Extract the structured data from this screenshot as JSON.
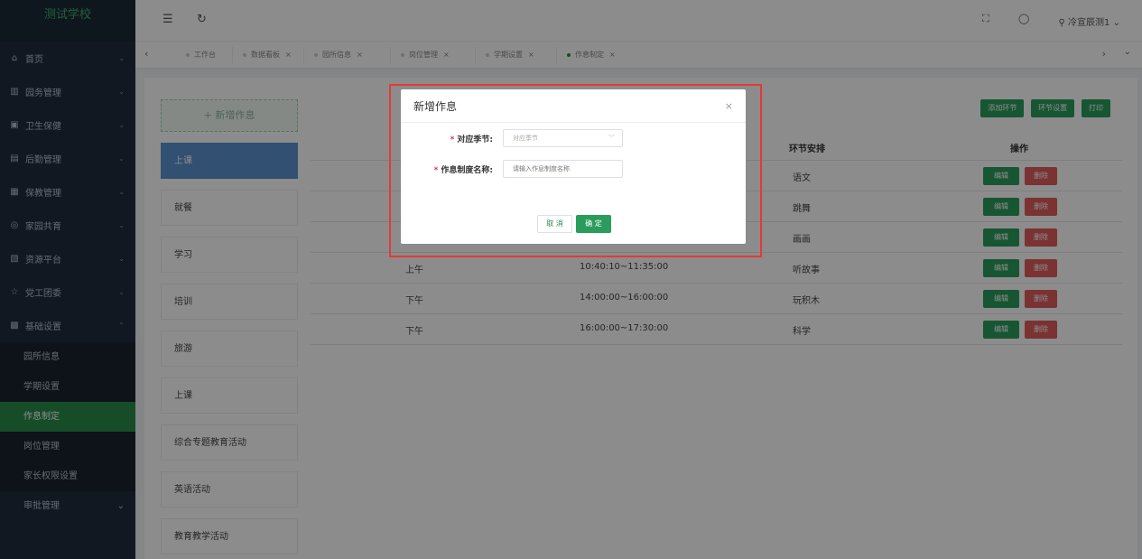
{
  "app": {
    "logo": "测试学校"
  },
  "sidebar": {
    "items": [
      {
        "icon": "home-icon",
        "glyph": "⌂",
        "label": "首页"
      },
      {
        "icon": "bank-icon",
        "glyph": "▥",
        "label": "园务管理"
      },
      {
        "icon": "health-icon",
        "glyph": "▣",
        "label": "卫生保健"
      },
      {
        "icon": "logistics-icon",
        "glyph": "▤",
        "label": "后勤管理"
      },
      {
        "icon": "care-icon",
        "glyph": "▦",
        "label": "保教管理"
      },
      {
        "icon": "family-icon",
        "glyph": "◎",
        "label": "家园共育"
      },
      {
        "icon": "resource-icon",
        "glyph": "▧",
        "label": "资源平台"
      },
      {
        "icon": "star-icon",
        "glyph": "☆",
        "label": "党工团委"
      },
      {
        "icon": "settings-grid-icon",
        "glyph": "▩",
        "label": "基础设置"
      }
    ],
    "subitems": [
      "园所信息",
      "学期设置",
      "作息制定",
      "岗位管理",
      "家长权限设置"
    ],
    "last_item": "审批管理"
  },
  "header": {
    "user": "冷宣辰测1"
  },
  "tabs": [
    {
      "label": "工作台",
      "closable": false
    },
    {
      "label": "数据看板",
      "closable": true
    },
    {
      "label": "园所信息",
      "closable": true
    },
    {
      "label": "岗位管理",
      "closable": true
    },
    {
      "label": "学期设置",
      "closable": true
    },
    {
      "label": "作息制定",
      "closable": true
    }
  ],
  "left_panel": {
    "add_label": "+ 新增作息",
    "items": [
      "上课",
      "就餐",
      "学习",
      "培训",
      "旅游",
      "上课",
      "综合专题教育活动",
      "英语活动",
      "教育教学活动"
    ]
  },
  "actions": {
    "add_segment": "添加环节",
    "segment_settings": "环节设置",
    "print": "打印"
  },
  "table": {
    "headers": {
      "arrangement": "环节安排",
      "operation": "操作"
    },
    "edit_label": "编辑",
    "delete_label": "删除",
    "rows": [
      {
        "period": "",
        "time": "",
        "activity": "语文"
      },
      {
        "period": "",
        "time": "",
        "activity": "跳舞"
      },
      {
        "period": "",
        "time": "",
        "activity": "画画"
      },
      {
        "period": "上午",
        "time": "10:40:10~11:35:00",
        "activity": "听故事"
      },
      {
        "period": "下午",
        "time": "14:00:00~16:00:00",
        "activity": "玩积木"
      },
      {
        "period": "下午",
        "time": "16:00:00~17:30:00",
        "activity": "科学"
      }
    ]
  },
  "modal": {
    "title": "新增作息",
    "close": "×",
    "season_label": "对应季节:",
    "season_placeholder": "对应季节",
    "name_label": "作息制度名称:",
    "name_placeholder": "请输入作息制度名称",
    "cancel": "取 消",
    "ok": "确 定"
  },
  "colors": {
    "accent": "#2a9d5c",
    "danger": "#e05c5c",
    "sidebar_bg": "#1f2d3d",
    "highlight": "#e53935"
  }
}
